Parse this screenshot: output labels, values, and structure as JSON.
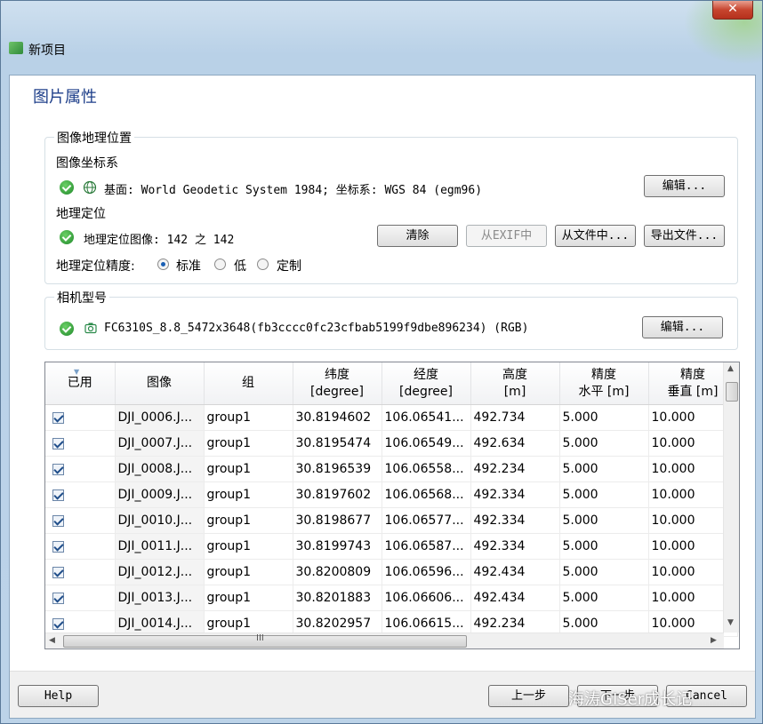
{
  "window": {
    "title": "新项目",
    "close_glyph": "✕"
  },
  "page": {
    "title": "图片属性"
  },
  "geo": {
    "legend": "图像地理位置",
    "coord_label": "图像坐标系",
    "coord_value": "基面: World Geodetic System 1984; 坐标系: WGS 84 (egm96)",
    "coord_edit": "编辑...",
    "geoloc_label": "地理定位",
    "geoloc_value": "地理定位图像: 142 之 142",
    "btn_clear": "清除",
    "btn_exif": "从EXIF中",
    "btn_fromfile": "从文件中...",
    "btn_export": "导出文件...",
    "accuracy_label": "地理定位精度:",
    "accuracy_options": [
      "标准",
      "低",
      "定制"
    ],
    "accuracy_selected": "标准"
  },
  "camera": {
    "legend": "相机型号",
    "value": "FC6310S_8.8_5472x3648(fb3cccc0fc23cfbab5199f9dbe896234) (RGB)",
    "edit": "编辑..."
  },
  "table": {
    "headers": [
      {
        "l1": "已用",
        "l2": ""
      },
      {
        "l1": "图像",
        "l2": ""
      },
      {
        "l1": "组",
        "l2": ""
      },
      {
        "l1": "纬度",
        "l2": "[degree]"
      },
      {
        "l1": "经度",
        "l2": "[degree]"
      },
      {
        "l1": "高度",
        "l2": "[m]"
      },
      {
        "l1": "精度",
        "l2": "水平 [m]"
      },
      {
        "l1": "精度",
        "l2": "垂直 [m]"
      }
    ],
    "rows": [
      {
        "used": true,
        "image": "DJI_0006.J...",
        "group": "group1",
        "lat": "30.8194602",
        "lon": "106.06541...",
        "alt": "492.734",
        "h": "5.000",
        "v": "10.000"
      },
      {
        "used": true,
        "image": "DJI_0007.J...",
        "group": "group1",
        "lat": "30.8195474",
        "lon": "106.06549...",
        "alt": "492.634",
        "h": "5.000",
        "v": "10.000"
      },
      {
        "used": true,
        "image": "DJI_0008.J...",
        "group": "group1",
        "lat": "30.8196539",
        "lon": "106.06558...",
        "alt": "492.234",
        "h": "5.000",
        "v": "10.000"
      },
      {
        "used": true,
        "image": "DJI_0009.J...",
        "group": "group1",
        "lat": "30.8197602",
        "lon": "106.06568...",
        "alt": "492.334",
        "h": "5.000",
        "v": "10.000"
      },
      {
        "used": true,
        "image": "DJI_0010.J...",
        "group": "group1",
        "lat": "30.8198677",
        "lon": "106.06577...",
        "alt": "492.334",
        "h": "5.000",
        "v": "10.000"
      },
      {
        "used": true,
        "image": "DJI_0011.J...",
        "group": "group1",
        "lat": "30.8199743",
        "lon": "106.06587...",
        "alt": "492.334",
        "h": "5.000",
        "v": "10.000"
      },
      {
        "used": true,
        "image": "DJI_0012.J...",
        "group": "group1",
        "lat": "30.8200809",
        "lon": "106.06596...",
        "alt": "492.434",
        "h": "5.000",
        "v": "10.000"
      },
      {
        "used": true,
        "image": "DJI_0013.J...",
        "group": "group1",
        "lat": "30.8201883",
        "lon": "106.06606...",
        "alt": "492.434",
        "h": "5.000",
        "v": "10.000"
      },
      {
        "used": true,
        "image": "DJI_0014.J...",
        "group": "group1",
        "lat": "30.8202957",
        "lon": "106.06615...",
        "alt": "492.234",
        "h": "5.000",
        "v": "10.000"
      }
    ],
    "hscroll_grip": "III"
  },
  "footer": {
    "help": "Help",
    "back": "上一步",
    "next": "下一步",
    "cancel": "Cancel",
    "watermark": "海涛GISer成长记"
  },
  "colors": {
    "accent": "#1e3f8a",
    "ok_green": "#2f9a38",
    "frame": "#b9d1e7"
  }
}
